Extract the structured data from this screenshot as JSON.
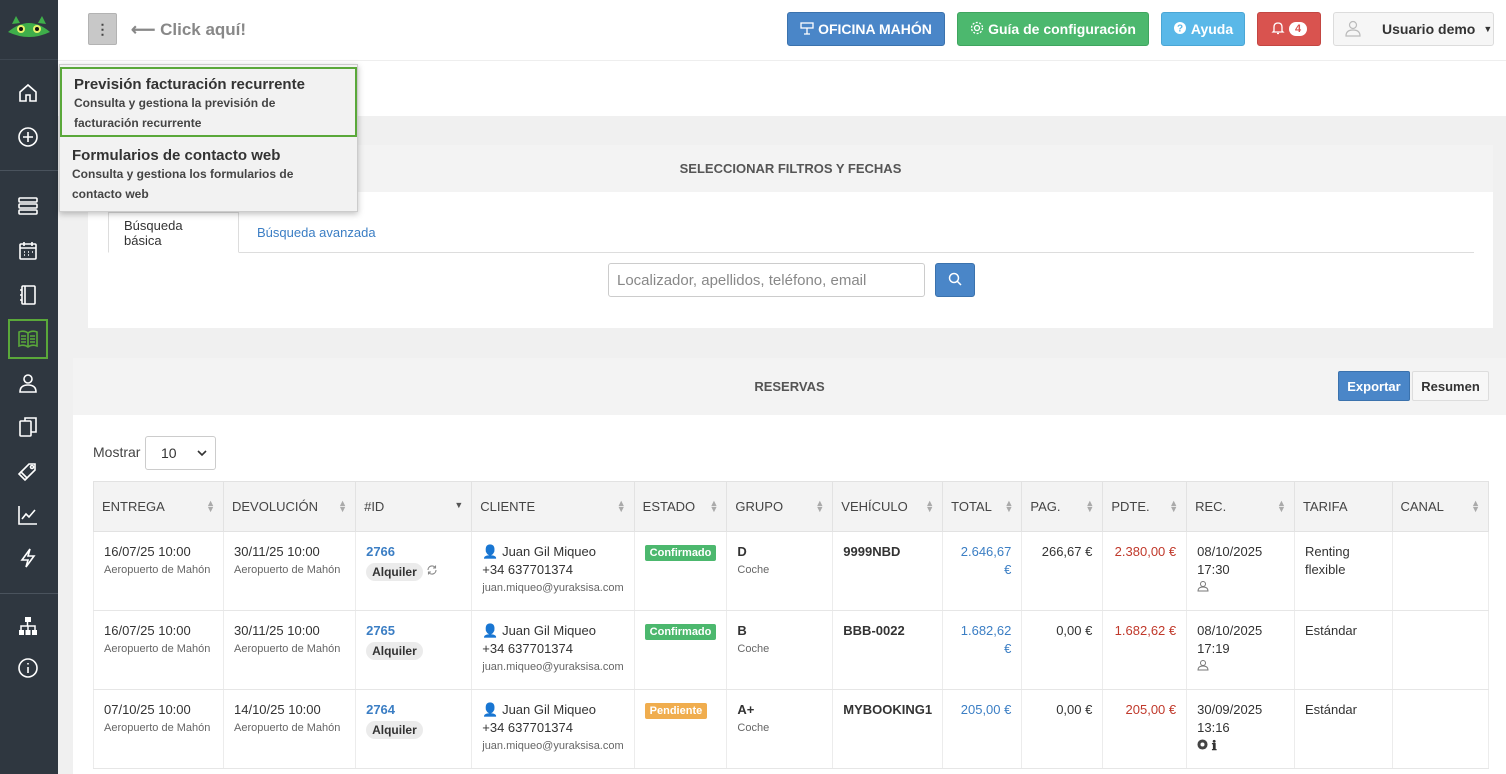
{
  "header": {
    "menu_toggle": "⋮",
    "click_hint": "⟵ Click aquí!",
    "office_label": "OFICINA MAHÓN",
    "guide_label": "Guía de configuración",
    "help_label": "Ayuda",
    "notifications_count": "4",
    "user_label": "Usuario demo"
  },
  "dropdown": {
    "items": [
      {
        "title": "Previsión facturación recurrente",
        "desc": "Consulta y gestiona la previsión de facturación recurrente"
      },
      {
        "title": "Formularios de contacto web",
        "desc": "Consulta y gestiona los formularios de contacto web"
      }
    ]
  },
  "filters": {
    "heading": "SELECCIONAR FILTROS Y FECHAS",
    "tab_basic": "Búsqueda básica",
    "tab_advanced": "Búsqueda avanzada",
    "search_placeholder": "Localizador, apellidos, teléfono, email"
  },
  "reservations": {
    "heading": "RESERVAS",
    "export_label": "Exportar",
    "summary_label": "Resumen",
    "show_label": "Mostrar",
    "show_value": "10",
    "columns": [
      "ENTREGA",
      "DEVOLUCIÓN",
      "#ID",
      "CLIENTE",
      "ESTADO",
      "GRUPO",
      "VEHÍCULO",
      "TOTAL",
      "PAG.",
      "PDTE.",
      "REC.",
      "TARIFA",
      "CANAL"
    ],
    "rows": [
      {
        "entrega": "16/07/25 10:00",
        "entrega_loc": "Aeropuerto de Mahón",
        "devolucion": "30/11/25 10:00",
        "devolucion_loc": "Aeropuerto de Mahón",
        "id": "2766",
        "tipo": "Alquiler",
        "cliente": "Juan Gil Miqueo",
        "telefono": "+34 637701374",
        "email": "juan.miqueo@yuraksisa.com",
        "estado": "Confirmado",
        "grupo": "D",
        "grupo_tipo": "Coche",
        "vehiculo": "9999NBD",
        "total": "2.646,67 €",
        "pagado": "266,67 €",
        "pendiente": "2.380,00 €",
        "rec": "08/10/2025 17:30",
        "tarifa": "Renting flexible",
        "canal": ""
      },
      {
        "entrega": "16/07/25 10:00",
        "entrega_loc": "Aeropuerto de Mahón",
        "devolucion": "30/11/25 10:00",
        "devolucion_loc": "Aeropuerto de Mahón",
        "id": "2765",
        "tipo": "Alquiler",
        "cliente": "Juan Gil Miqueo",
        "telefono": "+34 637701374",
        "email": "juan.miqueo@yuraksisa.com",
        "estado": "Confirmado",
        "grupo": "B",
        "grupo_tipo": "Coche",
        "vehiculo": "BBB-0022",
        "total": "1.682,62 €",
        "pagado": "0,00 €",
        "pendiente": "1.682,62 €",
        "rec": "08/10/2025 17:19",
        "tarifa": "Estándar",
        "canal": ""
      },
      {
        "entrega": "07/10/25 10:00",
        "entrega_loc": "Aeropuerto de Mahón",
        "devolucion": "14/10/25 10:00",
        "devolucion_loc": "Aeropuerto de Mahón",
        "id": "2764",
        "tipo": "Alquiler",
        "cliente": "Juan Gil Miqueo",
        "telefono": "+34 637701374",
        "email": "juan.miqueo@yuraksisa.com",
        "estado": "Pendiente",
        "grupo": "A+",
        "grupo_tipo": "Coche",
        "vehiculo": "MYBOOKING1",
        "total": "205,00 €",
        "pagado": "0,00 €",
        "pendiente": "205,00 €",
        "rec": "30/09/2025 13:16",
        "tarifa": "Estándar",
        "canal": ""
      }
    ]
  },
  "colors": {
    "primary": "#4a86c8",
    "success": "#4cb86e",
    "info": "#5ab8e8",
    "danger": "#d9534f",
    "warning": "#f0ad4e",
    "sidebar": "#2f3740",
    "highlight": "#5aa83a"
  }
}
